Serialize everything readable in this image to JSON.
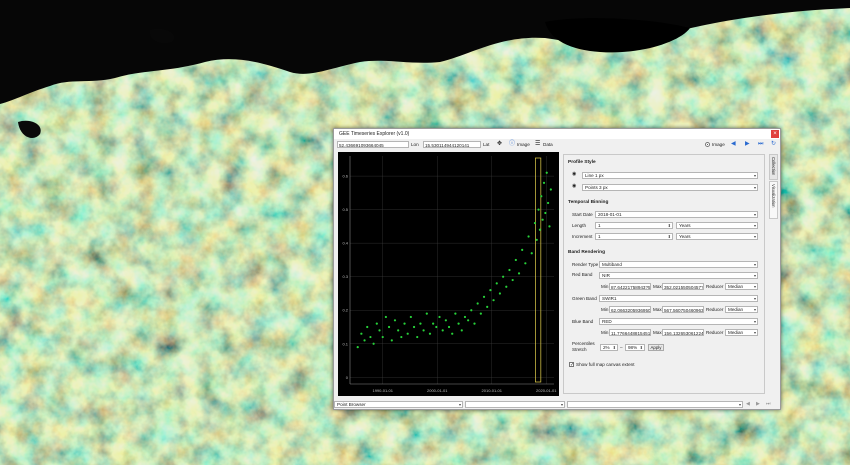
{
  "window": {
    "title": "GEE Timeseries Explorer (v1.0)",
    "close_glyph": "×"
  },
  "toolbar": {
    "lon_value": "52.436691093664045",
    "lon_label": "Lon",
    "lat_value": "15.530114944120141",
    "lat_label": "Lat",
    "image_label": "Image",
    "data_label": "Data",
    "right_image_label": "Image"
  },
  "profile_style": {
    "heading": "Profile Style",
    "line": "Line 1 px",
    "points": "Points 3 px"
  },
  "temporal_binning": {
    "heading": "Temporal Binning",
    "start_date_label": "Start Date",
    "start_date": "2018-01-01",
    "length_label": "Length",
    "length_value": "1",
    "length_unit": "Years",
    "increment_label": "Increment",
    "increment_value": "1",
    "increment_unit": "Years"
  },
  "band_rendering": {
    "heading": "Band Rendering",
    "render_type_label": "Render Type",
    "render_type": "Multiband",
    "red_band_label": "Red Band",
    "red_band": "NIR",
    "red_min": "87.64221758943?5",
    "red_max": "352.02155050457?4",
    "green_band_label": "Green Band",
    "green_band": "SWIR1",
    "green_min": "62.06632059369509",
    "green_max": "567.5607504609637",
    "blue_band_label": "Blue Band",
    "blue_band": "RED",
    "blue_min": "11.7766448815451B",
    "blue_max": "156.1326530612246",
    "min_label": "Min",
    "max_label": "Max",
    "reducer_label": "Reducer",
    "reducer": "Median",
    "percentiles_label": "Percentiles",
    "stretch_label": "Stretch",
    "pct_low": "2%",
    "pct_sep": "–",
    "pct_high": "98%",
    "apply_label": "Apply"
  },
  "show_full_extent_label": "Show full map canvas extent",
  "side_tabs": [
    "Collection",
    "Visualization"
  ],
  "bottom": {
    "browser_select": "Point Browser"
  },
  "colors": {
    "points": "#27d33a",
    "selection_box": "#e8d44d",
    "plot_bg": "#000000"
  },
  "chart_data": {
    "type": "scatter",
    "x_ticks": [
      "1990-01-01",
      "2000-01-01",
      "2010-01-01",
      "2020-01-01"
    ],
    "y_ticks": [
      "0",
      "0.1",
      "0.2",
      "0.3",
      "0.4",
      "0.5",
      "0.6"
    ],
    "xlim": [
      "1984-01-01",
      "2021-06-01"
    ],
    "ylim": [
      -0.02,
      0.66
    ],
    "grid": true,
    "series": [
      {
        "values": [
          [
            "1985-06-01",
            0.09
          ],
          [
            "1986-02-01",
            0.13
          ],
          [
            "1986-09-01",
            0.11
          ],
          [
            "1987-03-01",
            0.15
          ],
          [
            "1987-10-01",
            0.12
          ],
          [
            "1988-05-01",
            0.1
          ],
          [
            "1988-12-01",
            0.16
          ],
          [
            "1989-06-01",
            0.14
          ],
          [
            "1990-01-01",
            0.12
          ],
          [
            "1990-08-01",
            0.18
          ],
          [
            "1991-03-01",
            0.15
          ],
          [
            "1991-09-01",
            0.11
          ],
          [
            "1992-04-01",
            0.17
          ],
          [
            "1992-11-01",
            0.14
          ],
          [
            "1993-06-01",
            0.12
          ],
          [
            "1994-01-01",
            0.16
          ],
          [
            "1994-08-01",
            0.13
          ],
          [
            "1995-03-01",
            0.18
          ],
          [
            "1995-10-01",
            0.15
          ],
          [
            "1996-05-01",
            0.12
          ],
          [
            "1996-12-01",
            0.16
          ],
          [
            "1997-07-01",
            0.14
          ],
          [
            "1998-02-01",
            0.19
          ],
          [
            "1998-09-01",
            0.13
          ],
          [
            "1999-04-01",
            0.16
          ],
          [
            "1999-11-01",
            0.15
          ],
          [
            "2000-06-01",
            0.18
          ],
          [
            "2001-01-01",
            0.14
          ],
          [
            "2001-08-01",
            0.17
          ],
          [
            "2002-03-01",
            0.15
          ],
          [
            "2002-10-01",
            0.13
          ],
          [
            "2003-05-01",
            0.19
          ],
          [
            "2003-12-01",
            0.16
          ],
          [
            "2004-07-01",
            0.14
          ],
          [
            "2005-02-01",
            0.18
          ],
          [
            "2005-09-01",
            0.17
          ],
          [
            "2006-04-01",
            0.2
          ],
          [
            "2006-11-01",
            0.16
          ],
          [
            "2007-06-01",
            0.22
          ],
          [
            "2008-01-01",
            0.19
          ],
          [
            "2008-08-01",
            0.24
          ],
          [
            "2009-03-01",
            0.21
          ],
          [
            "2009-10-01",
            0.26
          ],
          [
            "2010-05-01",
            0.23
          ],
          [
            "2010-12-01",
            0.28
          ],
          [
            "2011-07-01",
            0.25
          ],
          [
            "2012-02-01",
            0.3
          ],
          [
            "2012-09-01",
            0.27
          ],
          [
            "2013-04-01",
            0.32
          ],
          [
            "2013-11-01",
            0.29
          ],
          [
            "2014-06-01",
            0.35
          ],
          [
            "2015-01-01",
            0.31
          ],
          [
            "2015-08-01",
            0.38
          ],
          [
            "2016-03-01",
            0.34
          ],
          [
            "2016-10-01",
            0.42
          ],
          [
            "2017-05-01",
            0.37
          ],
          [
            "2017-12-01",
            0.46
          ],
          [
            "2018-04-01",
            0.41
          ],
          [
            "2018-08-01",
            0.5
          ],
          [
            "2018-11-01",
            0.44
          ],
          [
            "2019-02-01",
            0.54
          ],
          [
            "2019-05-01",
            0.47
          ],
          [
            "2019-08-01",
            0.58
          ],
          [
            "2019-11-01",
            0.49
          ],
          [
            "2020-02-01",
            0.61
          ],
          [
            "2020-05-01",
            0.52
          ],
          [
            "2020-08-01",
            0.45
          ],
          [
            "2020-11-01",
            0.56
          ]
        ]
      }
    ]
  }
}
